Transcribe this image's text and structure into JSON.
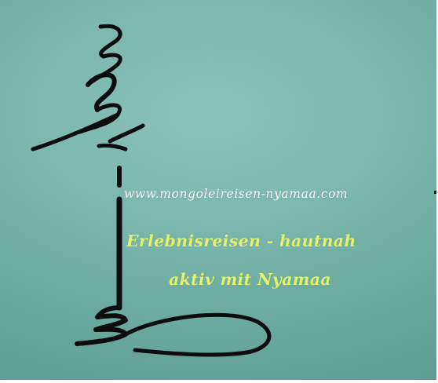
{
  "banner": {
    "background_color": "#7cb8ae",
    "logo": {
      "icon": "mongolian-script-calligraphy-icon",
      "stroke_color": "#0d0d0d"
    },
    "website_url": "www.mongoleireisen-nyamaa.com",
    "tagline_line_1": "Erlebnisreisen -  hautnah",
    "tagline_line_2": "aktiv mit Nyamaa",
    "tagline_color": "#e2f26a",
    "url_color": "#ffffff"
  }
}
